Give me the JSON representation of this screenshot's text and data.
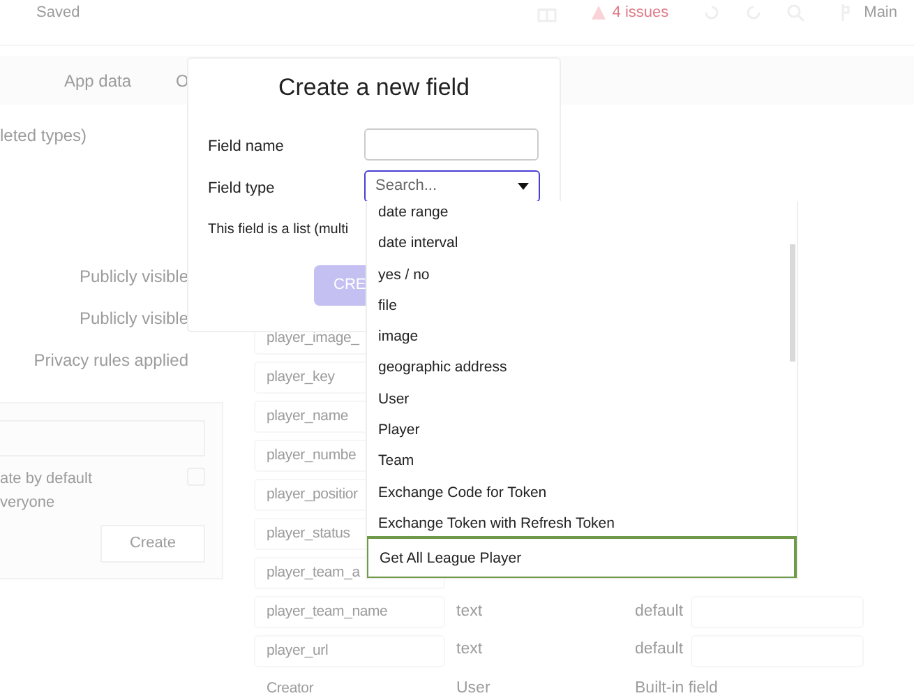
{
  "top_bar": {
    "status": "Saved",
    "issues": "4 issues",
    "branch": "Main"
  },
  "tabs": [
    "App data",
    "O"
  ],
  "types_note": "leted types)",
  "privacy_rows": [
    "Publicly visible",
    "Publicly visible",
    "Privacy rules applied"
  ],
  "privacy_panel": {
    "option_label": "ate by default",
    "option_hint": "veryone",
    "checked": false,
    "button": "Create"
  },
  "fields": [
    {
      "kind": "custom",
      "name": "player_image_"
    },
    {
      "kind": "custom",
      "name": "player_key"
    },
    {
      "kind": "custom",
      "name": "player_name"
    },
    {
      "kind": "custom",
      "name": "player_numbe"
    },
    {
      "kind": "custom",
      "name": "player_positior"
    },
    {
      "kind": "custom",
      "name": "player_status"
    },
    {
      "kind": "custom",
      "name": "player_team_a"
    },
    {
      "kind": "custom",
      "name": "player_team_name",
      "type": "text",
      "default_label": "default"
    },
    {
      "kind": "custom",
      "name": "player_url",
      "type": "text",
      "default_label": "default"
    },
    {
      "kind": "builtin",
      "name": "Creator",
      "type": "User",
      "note": "Built-in field"
    }
  ],
  "modal": {
    "title": "Create a new field",
    "name_label": "Field name",
    "type_label": "Field type",
    "type_placeholder": "Search...",
    "list_label": "This field is a list (multi",
    "button": "CRE"
  },
  "dropdown": {
    "options": [
      {
        "label": "date range",
        "selected": false
      },
      {
        "label": "date interval",
        "selected": false
      },
      {
        "label": "yes / no",
        "selected": false
      },
      {
        "label": "file",
        "selected": false
      },
      {
        "label": "image",
        "selected": false
      },
      {
        "label": "geographic address",
        "selected": false
      },
      {
        "label": "User",
        "selected": false
      },
      {
        "label": "Player",
        "selected": false
      },
      {
        "label": "Team",
        "selected": false
      },
      {
        "label": "Exchange Code for Token",
        "selected": false
      },
      {
        "label": "Exchange Token with Refresh Token",
        "selected": false
      },
      {
        "label": "Get All League Player",
        "selected": true
      }
    ]
  }
}
